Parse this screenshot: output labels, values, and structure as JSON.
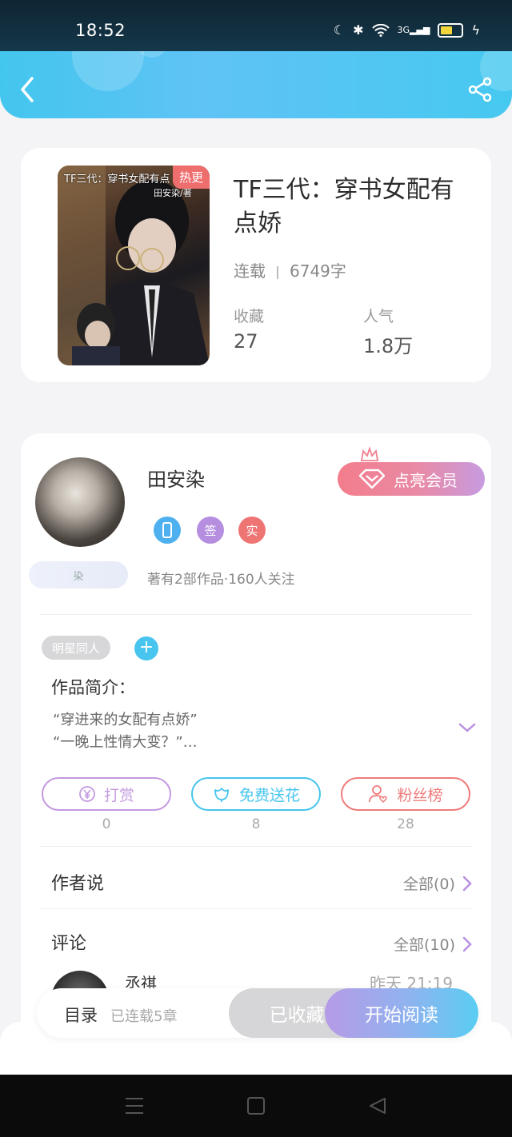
{
  "status_bar": {
    "time": "18:52",
    "network": "3G"
  },
  "book": {
    "cover_badge": "热更",
    "cover_title": "TF三代：穿书女配有点",
    "cover_author": "田安染/著",
    "title": "TF三代：穿书女配有点娇",
    "status": "连载",
    "word_count": "6749字",
    "stats": [
      {
        "label": "收藏",
        "value": "27"
      },
      {
        "label": "人气",
        "value": "1.8万"
      }
    ]
  },
  "author": {
    "name": "田安染",
    "vip_label": "点亮会员",
    "badges": [
      {
        "text": "",
        "color": "#4fb0f0"
      },
      {
        "text": "签",
        "color": "#b68ee0"
      },
      {
        "text": "实",
        "color": "#ef7474"
      }
    ],
    "fan_tag": "染",
    "works_stats": "著有2部作品·160人关注"
  },
  "tags": [
    "明星同人"
  ],
  "intro": {
    "title": "作品简介：",
    "lines": [
      "“穿进来的女配有点娇”",
      "“一晚上性情大变？”…"
    ]
  },
  "actions": [
    {
      "label": "打赏",
      "count": "0",
      "color": "#c49ae0"
    },
    {
      "label": "免费送花",
      "count": "8",
      "color": "#47c5ee"
    },
    {
      "label": "粉丝榜",
      "count": "28",
      "color": "#ef7b7b"
    }
  ],
  "author_says": {
    "title": "作者说",
    "more": "全部(0)"
  },
  "comments": {
    "title": "评论",
    "more": "全部(10)",
    "first": {
      "user": "丞祺",
      "time": "昨天 21:19"
    }
  },
  "bottom": {
    "toc": "目录",
    "chapters": "已连载5章",
    "favorited": "已收藏",
    "read": "开始阅读"
  },
  "colors": {
    "accent": "#47c5ee",
    "purple": "#b98fe2",
    "pink": "#ef7b7b"
  }
}
